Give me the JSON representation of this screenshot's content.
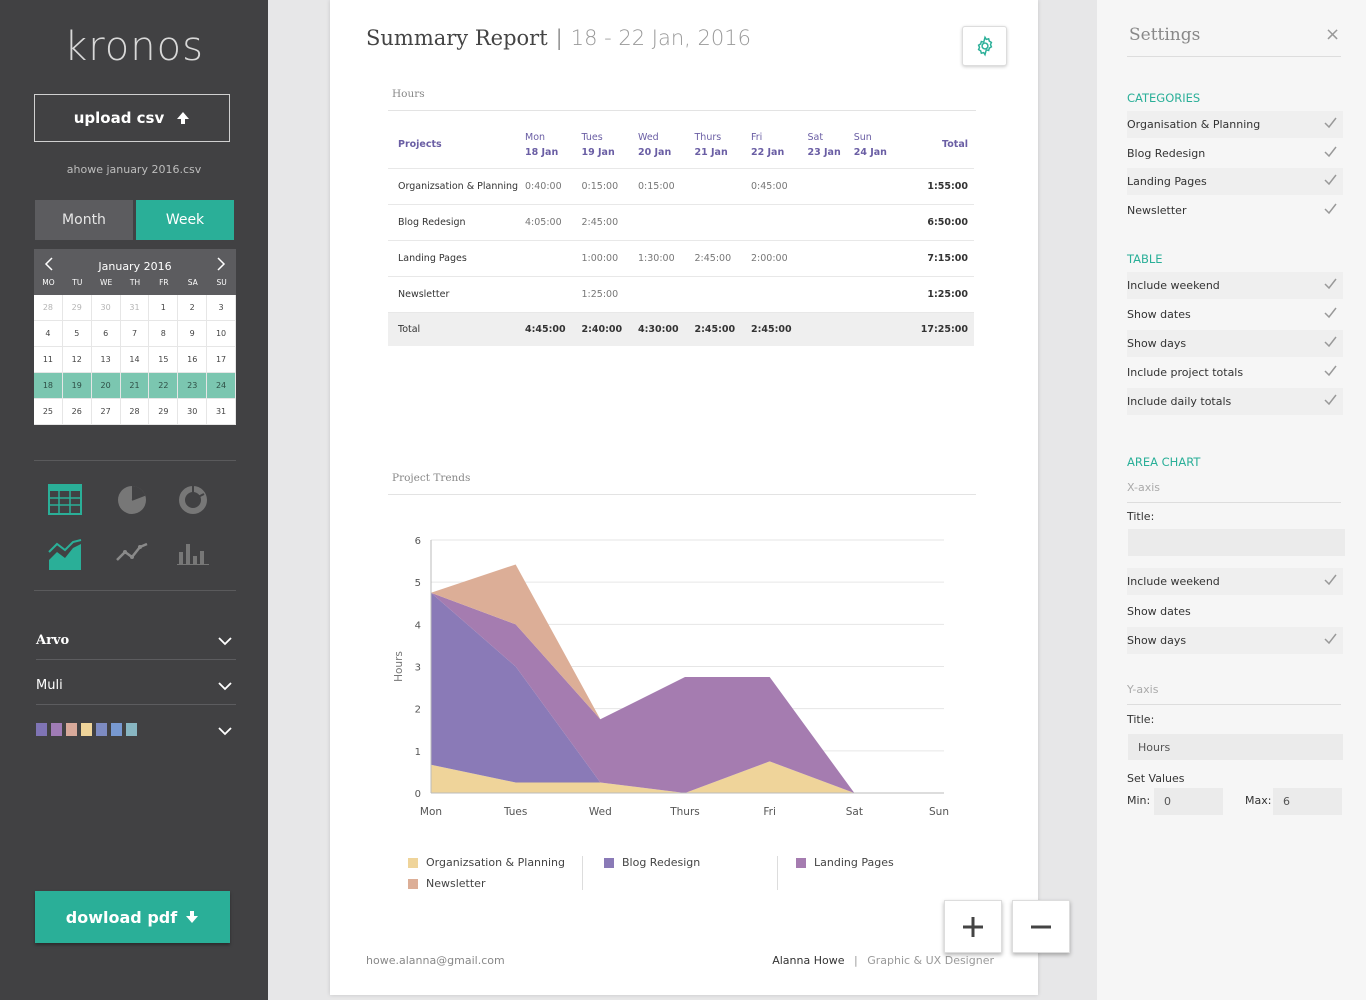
{
  "app": {
    "logo": "kronos"
  },
  "sidebar": {
    "upload_label": "upload csv",
    "filename": "ahowe january 2016.csv",
    "view_month": "Month",
    "view_week": "Week",
    "font_heading": "Arvo",
    "font_body": "Muli",
    "palette": [
      "#7f74b5",
      "#a07cb6",
      "#d8a99a",
      "#efd49a",
      "#7d8bc2",
      "#7899d1",
      "#88b6c2"
    ],
    "download_label": "dowload pdf"
  },
  "calendar": {
    "title": "January 2016",
    "dows": [
      "MO",
      "TU",
      "WE",
      "TH",
      "FR",
      "SA",
      "SU"
    ],
    "weeks": [
      [
        {
          "d": "28",
          "m": true
        },
        {
          "d": "29",
          "m": true
        },
        {
          "d": "30",
          "m": true
        },
        {
          "d": "31",
          "m": true
        },
        {
          "d": "1"
        },
        {
          "d": "2"
        },
        {
          "d": "3"
        }
      ],
      [
        {
          "d": "4"
        },
        {
          "d": "5"
        },
        {
          "d": "6"
        },
        {
          "d": "7"
        },
        {
          "d": "8"
        },
        {
          "d": "9"
        },
        {
          "d": "10"
        }
      ],
      [
        {
          "d": "11"
        },
        {
          "d": "12"
        },
        {
          "d": "13"
        },
        {
          "d": "14"
        },
        {
          "d": "15"
        },
        {
          "d": "16"
        },
        {
          "d": "17"
        }
      ],
      [
        {
          "d": "18",
          "s": true
        },
        {
          "d": "19",
          "s": true
        },
        {
          "d": "20",
          "s": true
        },
        {
          "d": "21",
          "s": true
        },
        {
          "d": "22",
          "s": true
        },
        {
          "d": "23",
          "s": true
        },
        {
          "d": "24",
          "s": true
        }
      ],
      [
        {
          "d": "25"
        },
        {
          "d": "26"
        },
        {
          "d": "27"
        },
        {
          "d": "28"
        },
        {
          "d": "29"
        },
        {
          "d": "30"
        },
        {
          "d": "31"
        }
      ]
    ]
  },
  "report": {
    "title": "Summary Report",
    "separator": "|",
    "dates": "18 - 22 Jan, 2016",
    "hours_label": "Hours",
    "trends_label": "Project Trends",
    "table": {
      "projects_header": "Projects",
      "total_header": "Total",
      "days": [
        {
          "day": "Mon",
          "date": "18 Jan"
        },
        {
          "day": "Tues",
          "date": "19 Jan"
        },
        {
          "day": "Wed",
          "date": "20 Jan"
        },
        {
          "day": "Thurs",
          "date": "21 Jan"
        },
        {
          "day": "Fri",
          "date": "22 Jan"
        },
        {
          "day": "Sat",
          "date": "23 Jan"
        },
        {
          "day": "Sun",
          "date": "24 Jan"
        }
      ],
      "rows": [
        {
          "name": "Organizsation & Planning",
          "cells": [
            "0:40:00",
            "0:15:00",
            "0:15:00",
            "",
            "0:45:00",
            "",
            ""
          ],
          "total": "1:55:00"
        },
        {
          "name": "Blog Redesign",
          "cells": [
            "4:05:00",
            "2:45:00",
            "",
            "",
            "",
            "",
            ""
          ],
          "total": "6:50:00"
        },
        {
          "name": "Landing Pages",
          "cells": [
            "",
            "1:00:00",
            "1:30:00",
            "2:45:00",
            "2:00:00",
            "",
            ""
          ],
          "total": "7:15:00"
        },
        {
          "name": "Newsletter",
          "cells": [
            "",
            "1:25:00",
            "",
            "",
            "",
            "",
            ""
          ],
          "total": "1:25:00"
        }
      ],
      "total_row": {
        "name": "Total",
        "cells": [
          "4:45:00",
          "2:40:00",
          "4:30:00",
          "2:45:00",
          "2:45:00",
          "",
          ""
        ],
        "total": "17:25:00"
      }
    },
    "email": "howe.alanna@gmail.com",
    "author": "Alanna Howe",
    "author_sep": "|",
    "role": "Graphic & UX Designer"
  },
  "chart_data": {
    "type": "area",
    "categories": [
      "Mon",
      "Tues",
      "Wed",
      "Thurs",
      "Fri",
      "Sat",
      "Sun"
    ],
    "ylabel": "Hours",
    "ylim": [
      0,
      6
    ],
    "yticks": [
      0,
      1,
      2,
      3,
      4,
      5,
      6
    ],
    "series": [
      {
        "name": "Organizsation & Planning",
        "color": "#efd49a",
        "values": [
          0.67,
          0.25,
          0.25,
          0,
          0.75,
          0,
          0
        ]
      },
      {
        "name": "Blog Redesign",
        "color": "#8a7ab7",
        "values": [
          4.08,
          2.75,
          0,
          0,
          0,
          0,
          0
        ]
      },
      {
        "name": "Landing Pages",
        "color": "#a57cb0",
        "values": [
          0,
          1,
          1.5,
          2.75,
          2,
          0,
          0
        ]
      },
      {
        "name": "Newsletter",
        "color": "#dcae97",
        "values": [
          0,
          1.42,
          0,
          0,
          0,
          0,
          0
        ]
      }
    ],
    "legend": [
      "Organizsation & Planning",
      "Blog Redesign",
      "Landing Pages",
      "Newsletter"
    ]
  },
  "settings": {
    "title": "Settings",
    "close": "×",
    "categories_head": "CATEGORIES",
    "categories": [
      "Organisation & Planning",
      "Blog Redesign",
      "Landing Pages",
      "Newsletter"
    ],
    "table_head": "TABLE",
    "table_opts": [
      "Include weekend",
      "Show dates",
      "Show days",
      "Include project totals",
      "Include daily totals"
    ],
    "area_head": "AREA CHART",
    "xaxis": "X-axis",
    "title_label": "Title:",
    "x_title_value": "",
    "x_opts": [
      {
        "label": "Include weekend",
        "checked": true
      },
      {
        "label": "Show dates",
        "checked": false
      },
      {
        "label": "Show days",
        "checked": true
      }
    ],
    "yaxis": "Y-axis",
    "y_title_value": "Hours",
    "set_values": "Set Values",
    "min_label": "Min:",
    "min_value": "0",
    "max_label": "Max:",
    "max_value": "6"
  }
}
